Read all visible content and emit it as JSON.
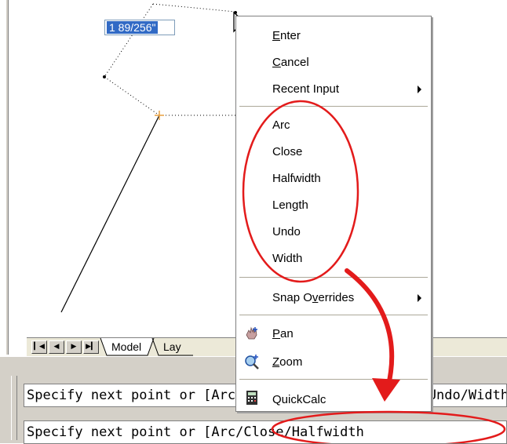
{
  "dynamic_input": {
    "value": "1 89/256\""
  },
  "menu": {
    "enter": {
      "mnemonic": "E",
      "rest": "nter"
    },
    "cancel": {
      "mnemonic": "C",
      "rest": "ancel"
    },
    "recent_input": "Recent Input",
    "options": [
      "Arc",
      "Close",
      "Halfwidth",
      "Length",
      "Undo",
      "Width"
    ],
    "snap_overrides": {
      "before": "Snap O",
      "mnemonic": "v",
      "after": "errides"
    },
    "pan": {
      "mnemonic": "P",
      "rest": "an"
    },
    "zoom": {
      "mnemonic": "Z",
      "rest": "oom"
    },
    "quickcalc": "QuickCalc"
  },
  "tabs": {
    "model": "Model",
    "layout_partial": "Lay"
  },
  "command_line": {
    "line1": "Specify next point or [Arc/Close/Halfwidth/Length/Undo/Width]",
    "line2": "Specify next point or [Arc/Close/Halfwidth"
  },
  "colors": {
    "annotation_red": "#e31b1b",
    "selection_blue": "#316ac5"
  },
  "icons": [
    "cursor-arrow-icon",
    "submenu-arrow-icon",
    "pan-hand-icon",
    "zoom-magnifier-icon",
    "calculator-icon",
    "first-tab-icon",
    "prev-tab-icon",
    "next-tab-icon",
    "last-tab-icon"
  ]
}
